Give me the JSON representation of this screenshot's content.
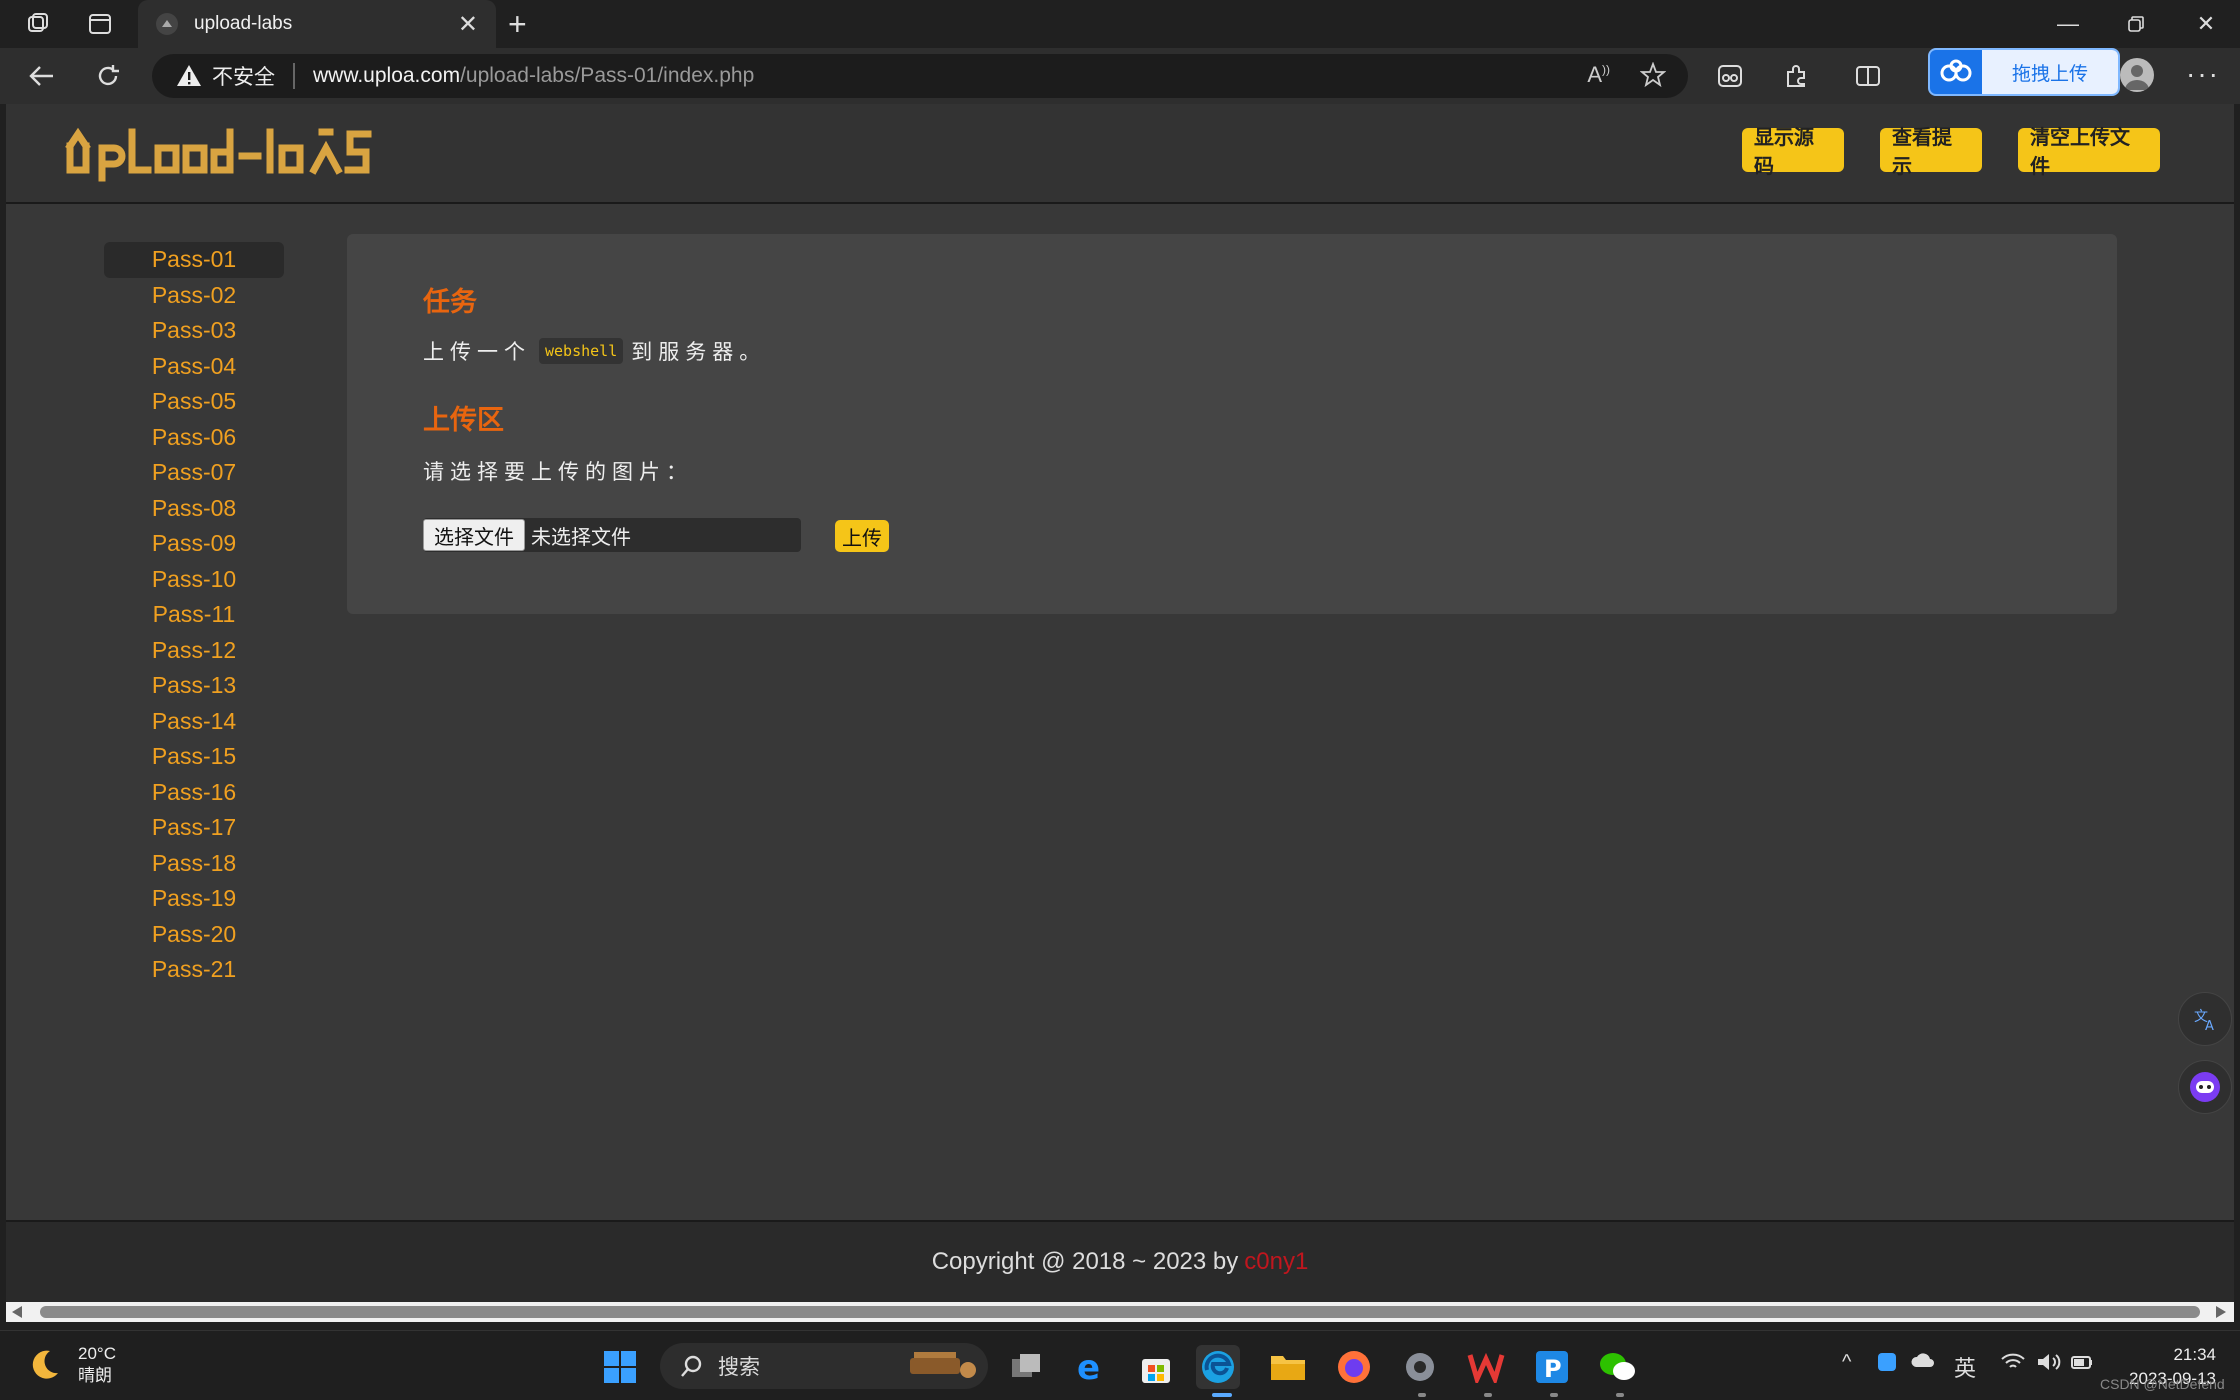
{
  "browser": {
    "tab_title": "upload-labs",
    "security_label": "不安全",
    "url_host": "www.uploa.com",
    "url_path": "/upload-labs/Pass-01/index.php",
    "baidu_upload_label": "拖拽上传"
  },
  "page": {
    "logo_text": "UpLoad-labS",
    "header_buttons": [
      "显示源码",
      "查看提示",
      "清空上传文件"
    ],
    "sidebar": [
      "Pass-01",
      "Pass-02",
      "Pass-03",
      "Pass-04",
      "Pass-05",
      "Pass-06",
      "Pass-07",
      "Pass-08",
      "Pass-09",
      "Pass-10",
      "Pass-11",
      "Pass-12",
      "Pass-13",
      "Pass-14",
      "Pass-15",
      "Pass-16",
      "Pass-17",
      "Pass-18",
      "Pass-19",
      "Pass-20",
      "Pass-21"
    ],
    "active_pass": "Pass-01",
    "task_title": "任务",
    "task_before": "上传一个",
    "task_code": "webshell",
    "task_after": "到服务器。",
    "upload_title": "上传区",
    "upload_prompt": "请选择要上传的图片：",
    "choose_file_label": "选择文件",
    "no_file_label": "未选择文件",
    "upload_button": "上传",
    "footer_text": "Copyright @ 2018 ~ 2023 by",
    "footer_author": "c0ny1"
  },
  "taskbar": {
    "temperature": "20°C",
    "weather": "晴朗",
    "search_label": "搜索",
    "ime": "英",
    "time": "21:34",
    "date": "2023-09-13",
    "watermark": "CSDN @NetDefend"
  },
  "colors": {
    "accent_yellow": "#f5c518",
    "heading_orange": "#e8650f",
    "link_orange": "#f0a020",
    "author_red": "#c0161e"
  }
}
